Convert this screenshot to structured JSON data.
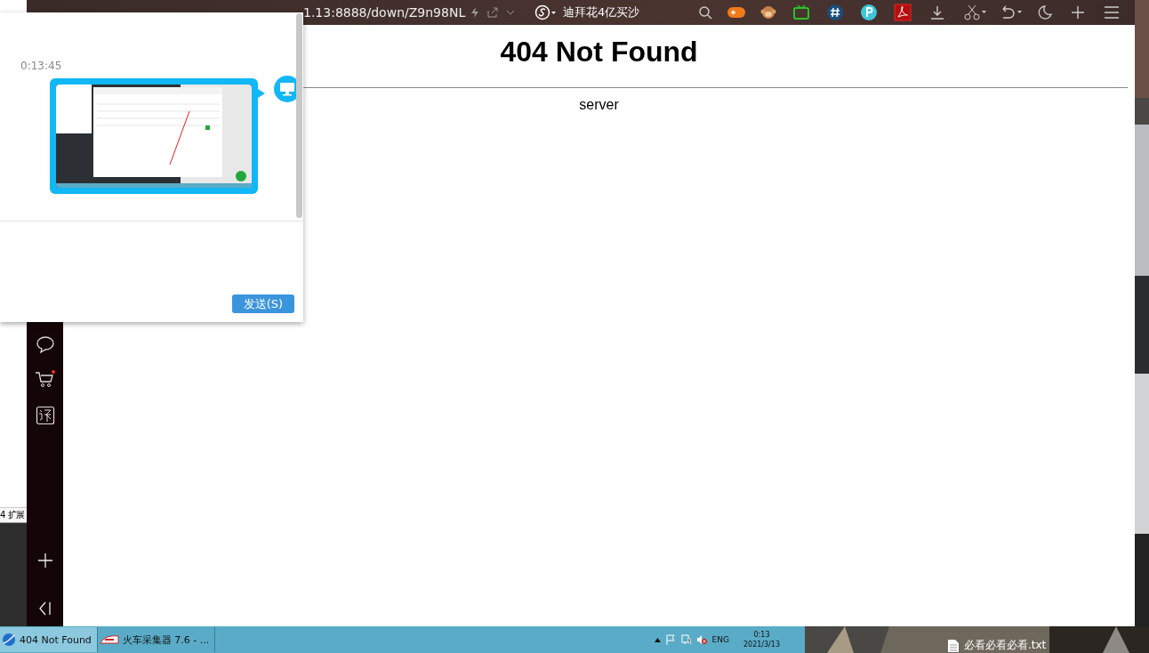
{
  "browser": {
    "address": "1.13:8888/down/Z9n98NL",
    "hot_search": "迪拜花4亿买沙",
    "page": {
      "heading": "404 Not Found",
      "text": "server"
    }
  },
  "sidebar": {
    "cart_notification": true
  },
  "chat": {
    "timestamp": "0:13:45",
    "send_button": "发送(S)"
  },
  "background_window": {
    "tab_text": "4 扩展"
  },
  "taskbar": {
    "items": [
      {
        "label": "404 Not Found",
        "selected": true
      },
      {
        "label": "火车采集器 7.6 - ...",
        "selected": false
      }
    ],
    "language": "ENG",
    "time": "0:13",
    "date": "2021/3/13"
  },
  "desktop": {
    "file": "必看必看必看.txt"
  }
}
